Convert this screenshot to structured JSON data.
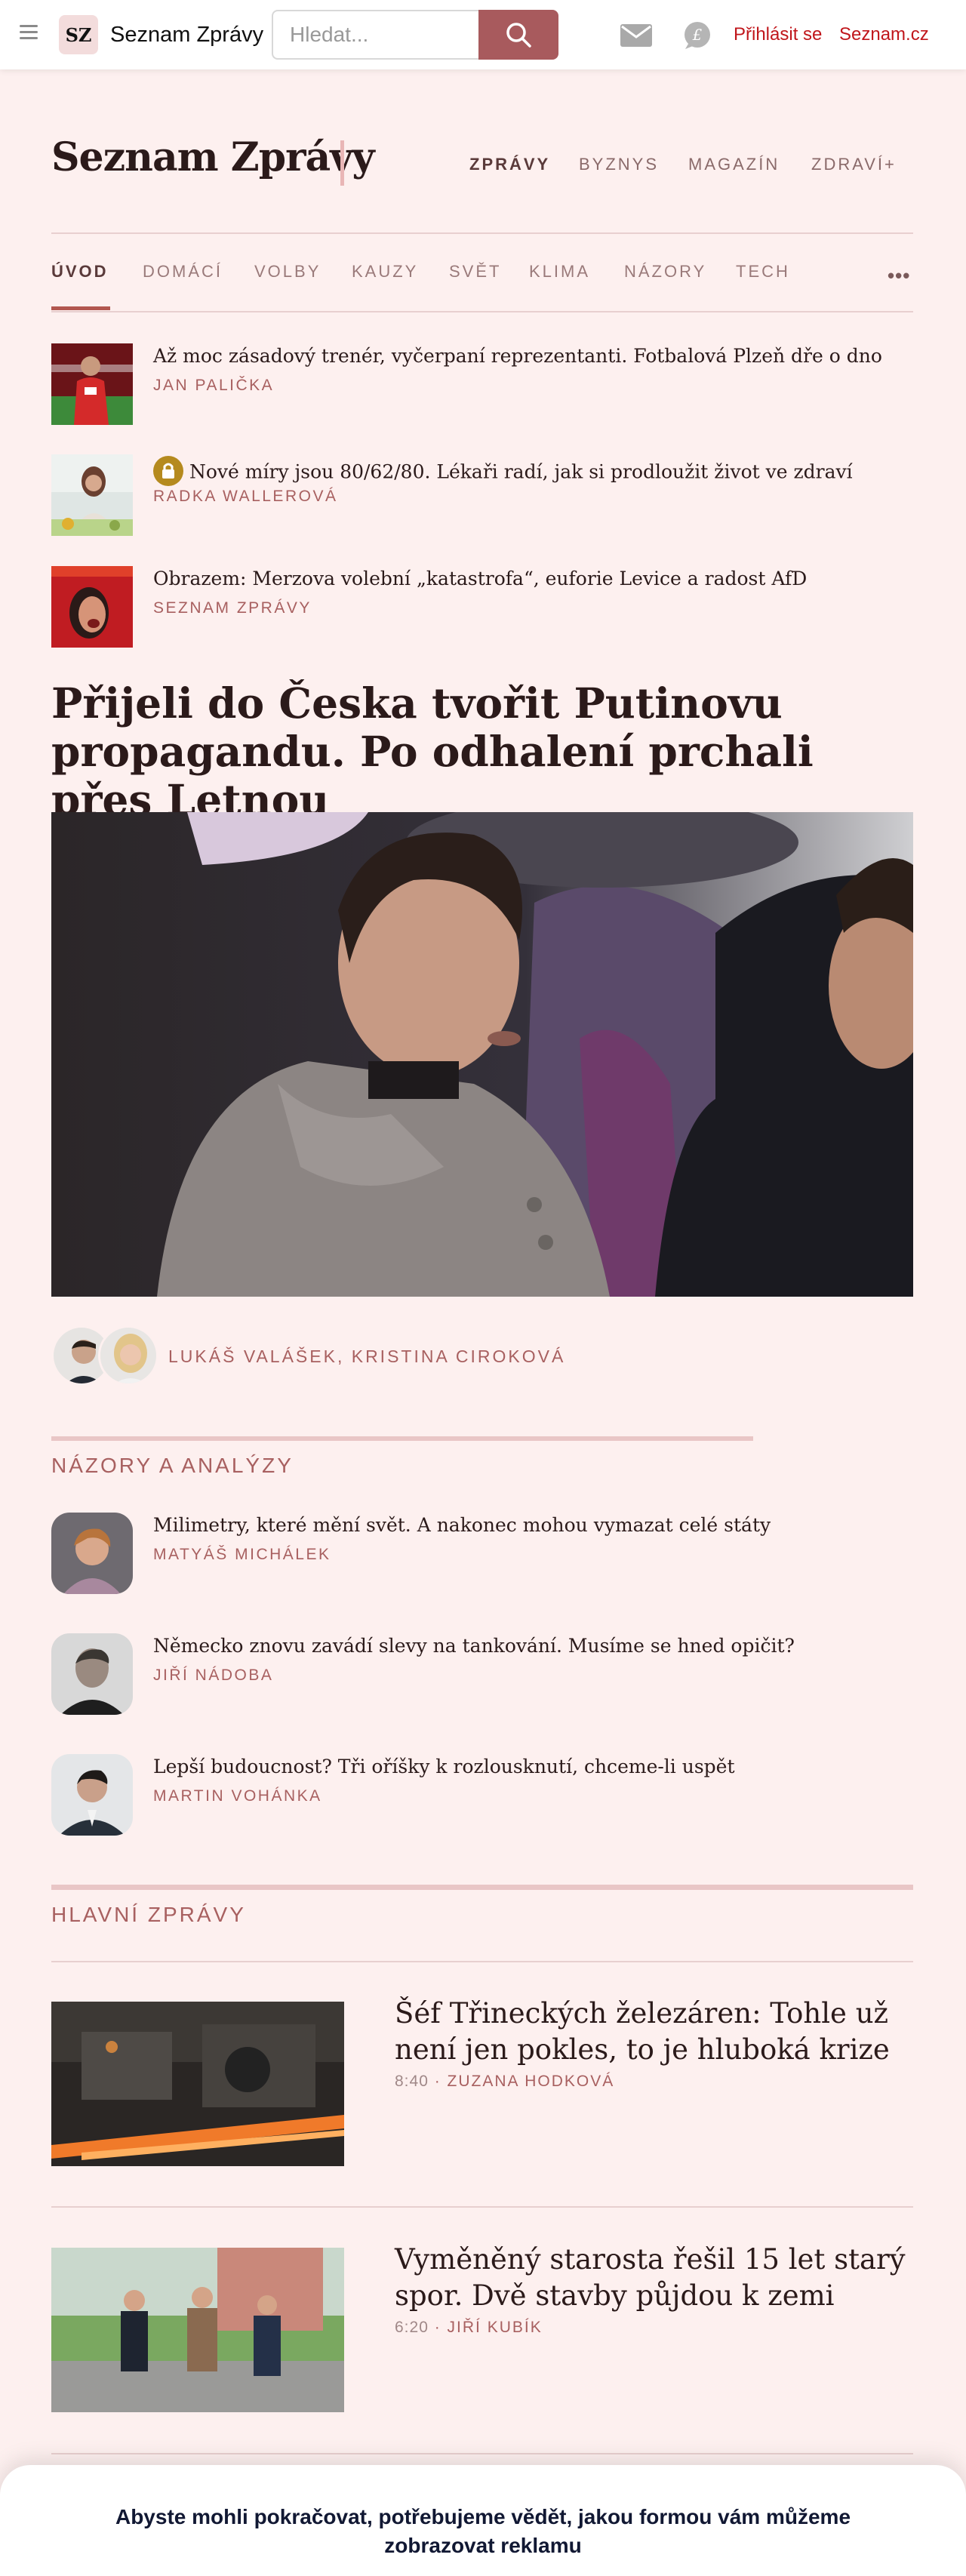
{
  "header": {
    "logo_badge": "SZ",
    "logo_text": "Seznam Zprávy",
    "search_placeholder": "Hledat...",
    "login": "Přihlásit se",
    "seznam_link": "Seznam.cz",
    "icons": [
      "menu-icon",
      "search-icon",
      "mail-icon",
      "chat-icon"
    ]
  },
  "masthead": {
    "title": "Seznam Zprávy",
    "sections": [
      "ZPRÁVY",
      "BYZNYS",
      "MAGAZÍN",
      "ZDRAVÍ+"
    ]
  },
  "nav": {
    "items": [
      "ÚVOD",
      "DOMÁCÍ",
      "VOLBY",
      "KAUZY",
      "SVĚT",
      "KLIMA",
      "NÁZORY",
      "TECH"
    ],
    "more": "•••"
  },
  "top_stories": [
    {
      "title": "Až moc zásadový trenér, vyčerpaní reprezentanti. Fotbalová Plzeň dře o dno",
      "author": "JAN PALIČKA"
    },
    {
      "title": "Nové míry jsou 80/62/80. Lékaři radí, jak si prodloužit život ve zdraví",
      "author": "RADKA WALLEROVÁ",
      "locked": true
    },
    {
      "title": "Obrazem: Merzova volební „katastrofa“, euforie Levice a radost AfD",
      "author": "SEZNAM ZPRÁVY"
    }
  ],
  "lead": {
    "title": "Přijeli do Česka tvořit Putinovu propagandu. Po odhalení prchali přes Letnou",
    "authors": "LUKÁŠ VALÁŠEK, KRISTINA CIROKOVÁ"
  },
  "opinions": {
    "heading": "NÁZORY A ANALÝZY",
    "items": [
      {
        "title": "Milimetry, které mění svět. A nakonec mohou vymazat celé státy",
        "author": "MATYÁŠ MICHÁLEK"
      },
      {
        "title": "Německo znovu zavádí slevy na tankování. Musíme se hned opičit?",
        "author": "JIŘÍ NÁDOBA"
      },
      {
        "title": "Lepší budoucnost? Tři oříšky k rozlousknutí, chceme-li uspět",
        "author": "MARTIN VOHÁNKA"
      }
    ]
  },
  "main_news": {
    "heading": "HLAVNÍ ZPRÁVY",
    "items": [
      {
        "title": "Šéf Třineckých železáren: Tohle už není jen pokles, to je hluboká krize",
        "time": "8:40",
        "author": "ZUZANA HODKOVÁ"
      },
      {
        "title": "Vyměněný starosta řešil 15 let starý spor. Dvě stavby půjdou k zemi",
        "time": "6:20",
        "author": "JIŘÍ KUBÍK"
      }
    ]
  },
  "consent": {
    "text": "Abyste mohli pokračovat, potřebujeme vědět, jakou formou vám můžeme zobrazovat reklamu"
  },
  "colors": {
    "page_bg": "#fdf0ef",
    "accent": "#a85a5d",
    "link_red": "#c0161b",
    "author": "#a86060"
  }
}
